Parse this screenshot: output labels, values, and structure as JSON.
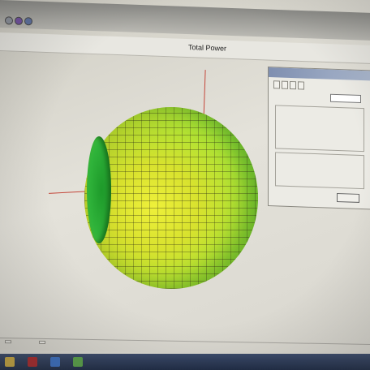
{
  "window": {
    "title": "Total Power"
  },
  "plot": {
    "axis_color": "#c4463a",
    "sphere_colors": [
      "#eef03a",
      "#aee234",
      "#54c63a"
    ]
  },
  "dialog": {
    "title": "",
    "tabs": [
      "",
      "",
      "",
      ""
    ],
    "ok_label": "",
    "group_label": ""
  },
  "bottom_tabs": [
    "",
    ""
  ],
  "taskbar": {
    "icons": [
      "app-icon",
      "app-icon",
      "app-icon"
    ]
  }
}
